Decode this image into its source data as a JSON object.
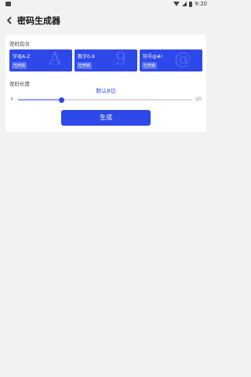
{
  "status_bar": {
    "time": "9:20"
  },
  "app_bar": {
    "title": "密码生成器"
  },
  "charset": {
    "label": "密码包含",
    "options": [
      {
        "label": "字母A-Z",
        "badge": "已开启",
        "glyph": "A"
      },
      {
        "label": "数字0-9",
        "badge": "已开启",
        "glyph": "9"
      },
      {
        "label": "符号@#!",
        "badge": "已开启",
        "glyph": "@"
      }
    ]
  },
  "length": {
    "label": "密码长度",
    "value_text": "默认8位",
    "min": "4",
    "max": "20",
    "value": 8
  },
  "generate": {
    "label": "生成"
  },
  "colors": {
    "accent": "#2e49ea",
    "track_fill": "#8fa0ff",
    "background": "#f2f2f2"
  }
}
